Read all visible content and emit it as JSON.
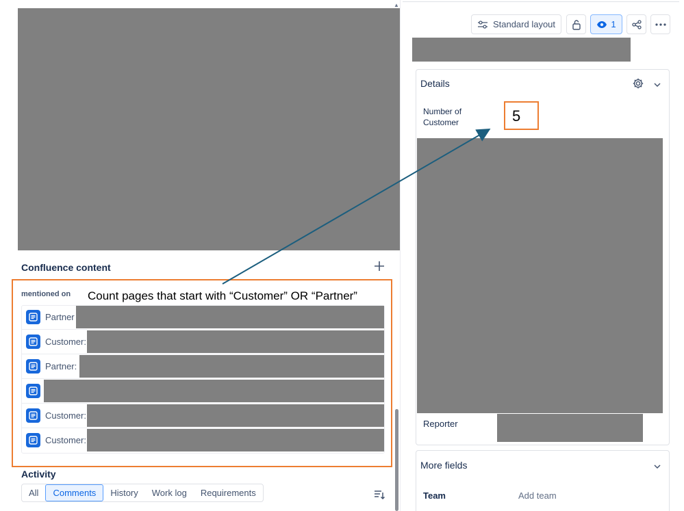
{
  "toolbar": {
    "layout_label": "Standard layout",
    "watch_count": "1",
    "icons": [
      "layout-settings-icon",
      "unlock-icon",
      "eye-icon",
      "share-icon",
      "more-icon"
    ]
  },
  "confluence": {
    "title": "Confluence content",
    "mentioned_on": "mentioned on",
    "pages": [
      {
        "prefix": "Partner"
      },
      {
        "prefix": "Customer:"
      },
      {
        "prefix": "Partner:"
      },
      {
        "prefix": ""
      },
      {
        "prefix": "Customer:"
      },
      {
        "prefix": "Customer:"
      }
    ]
  },
  "annotation": {
    "instruction": "Count pages that start with “Customer” OR “Partner”",
    "answer": "5",
    "box_color": "#ed7d31",
    "arrow_color": "#1b5e7e"
  },
  "details": {
    "title": "Details",
    "number_of_customer_label_line1": "Number of",
    "number_of_customer_label_line2": "Customer",
    "reporter_label": "Reporter"
  },
  "more_fields": {
    "title": "More fields",
    "team_label": "Team",
    "team_placeholder": "Add team"
  },
  "activity": {
    "title": "Activity",
    "tabs": [
      "All",
      "Comments",
      "History",
      "Work log",
      "Requirements"
    ],
    "active_tab": "Comments"
  },
  "colors": {
    "redaction": "#808080",
    "accent": "#0c66e4",
    "page_icon": "#1868db"
  }
}
